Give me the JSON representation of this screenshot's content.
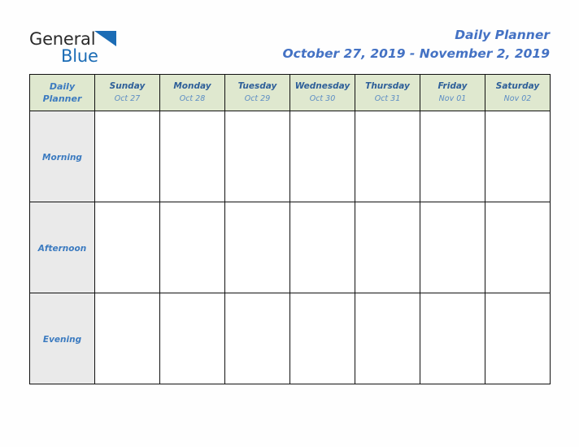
{
  "brand": {
    "name_part1": "General",
    "name_part2": "Blue",
    "logo_icon": "triangle-icon",
    "accent_blue": "#1b6cb5"
  },
  "header": {
    "title": "Daily Planner",
    "date_range": "October 27, 2019 - November 2, 2019",
    "title_color": "#4472c4"
  },
  "planner": {
    "corner_label_line1": "Daily",
    "corner_label_line2": "Planner",
    "header_bg": "#dfe8cf",
    "row_label_bg": "#eaeaea",
    "border_color": "#111111",
    "columns": [
      {
        "day": "Sunday",
        "date": "Oct 27"
      },
      {
        "day": "Monday",
        "date": "Oct 28"
      },
      {
        "day": "Tuesday",
        "date": "Oct 29"
      },
      {
        "day": "Wednesday",
        "date": "Oct 30"
      },
      {
        "day": "Thursday",
        "date": "Oct 31"
      },
      {
        "day": "Friday",
        "date": "Nov 01"
      },
      {
        "day": "Saturday",
        "date": "Nov 02"
      }
    ],
    "rows": [
      {
        "label": "Morning",
        "cells": [
          "",
          "",
          "",
          "",
          "",
          "",
          ""
        ]
      },
      {
        "label": "Afternoon",
        "cells": [
          "",
          "",
          "",
          "",
          "",
          "",
          ""
        ]
      },
      {
        "label": "Evening",
        "cells": [
          "",
          "",
          "",
          "",
          "",
          "",
          ""
        ]
      }
    ]
  }
}
